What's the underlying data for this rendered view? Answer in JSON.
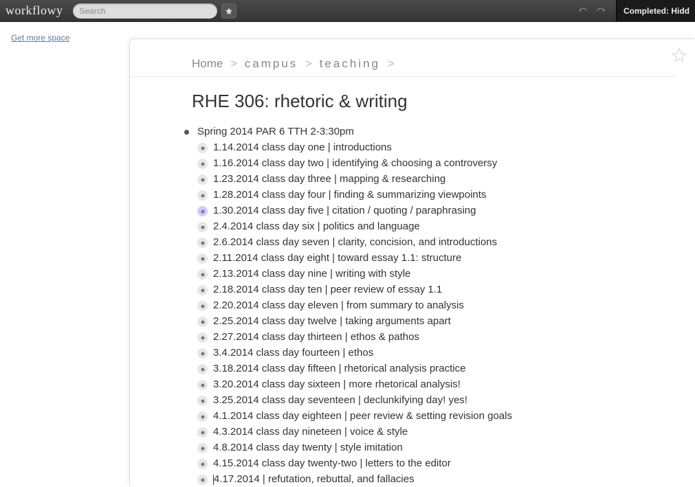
{
  "header": {
    "logo": "workflowy",
    "search_placeholder": "Search",
    "completed_label": "Completed: Hidd"
  },
  "sidebar": {
    "get_more": "Get more space"
  },
  "breadcrumb": {
    "home": "Home",
    "campus": "campus",
    "teaching": "teaching"
  },
  "title": "RHE 306: rhetoric & writing",
  "root_item": "Spring 2014 PAR 6 TTH 2-3:30pm",
  "items": [
    {
      "text": "1.14.2014 class day one | introductions",
      "highlight": false
    },
    {
      "text": "1.16.2014 class day two | identifying & choosing a controversy",
      "highlight": false
    },
    {
      "text": "1.23.2014 class day three | mapping & researching",
      "highlight": false
    },
    {
      "text": "1.28.2014 class day four | finding & summarizing viewpoints",
      "highlight": false
    },
    {
      "text": "1.30.2014 class day five  | citation / quoting / paraphrasing",
      "highlight": true
    },
    {
      "text": "2.4.2014 class day six | politics and language",
      "highlight": false
    },
    {
      "text": "2.6.2014 class day seven | clarity, concision, and introductions",
      "highlight": false
    },
    {
      "text": "2.11.2014 class day eight | toward essay 1.1: structure",
      "highlight": false
    },
    {
      "text": "2.13.2014 class day nine | writing with style",
      "highlight": false
    },
    {
      "text": "2.18.2014 class day ten | peer review of essay 1.1",
      "highlight": false
    },
    {
      "text": "2.20.2014 class day eleven | from summary to analysis",
      "highlight": false
    },
    {
      "text": "2.25.2014 class day twelve | taking arguments apart",
      "highlight": false
    },
    {
      "text": "2.27.2014 class day thirteen | ethos & pathos",
      "highlight": false
    },
    {
      "text": "3.4.2014 class day fourteen | ethos",
      "highlight": false
    },
    {
      "text": "3.18.2014 class day fifteen | rhetorical analysis practice",
      "highlight": false
    },
    {
      "text": "3.20.2014 class day sixteen | more rhetorical analysis!",
      "highlight": false
    },
    {
      "text": "3.25.2014 class day seventeen | declunkifying day! yes!",
      "highlight": false
    },
    {
      "text": "4.1.2014 class day eighteen | peer review & setting revision goals",
      "highlight": false
    },
    {
      "text": "4.3.2014 class day nineteen | voice & style",
      "highlight": false
    },
    {
      "text": "4.8.2014 class day twenty | style imitation",
      "highlight": false
    },
    {
      "text": "4.15.2014 class day twenty-two | letters to the editor",
      "highlight": false
    },
    {
      "text": "4.17.2014 | refutation, rebuttal, and fallacies",
      "highlight": false,
      "cursor": true
    }
  ]
}
